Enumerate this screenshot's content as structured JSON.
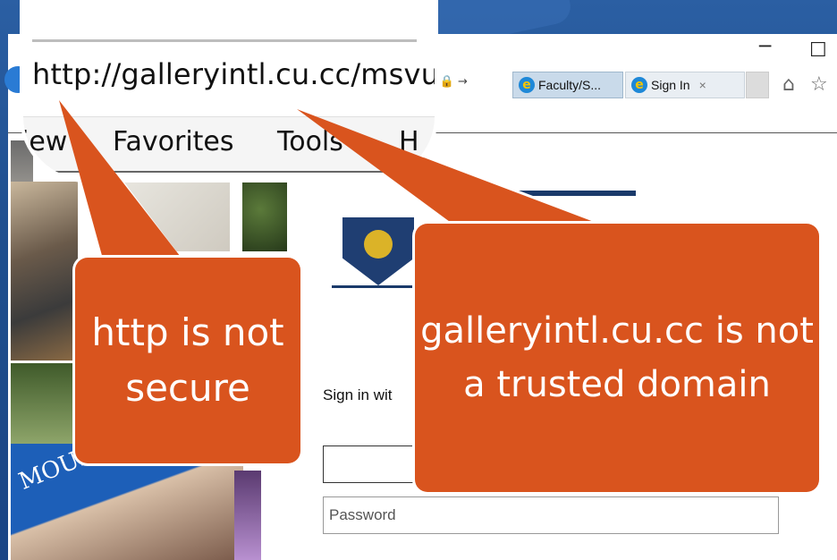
{
  "browser": {
    "address_url": "http://galleryintl.cu.cc/msvu",
    "address_tail": "▾ 🔒 →",
    "window_minimize": "─",
    "window_maximize": "☐",
    "tabs": [
      {
        "label": "Faculty/S...",
        "icon": "ie-icon"
      },
      {
        "label": "Sign In",
        "icon": "ie-icon",
        "close": "×"
      }
    ],
    "toolbar_icons": [
      "home-icon",
      "star-icon"
    ],
    "menu": [
      "iew",
      "Favorites",
      "Tools",
      "H"
    ]
  },
  "page": {
    "signin_text": "Sign in wit",
    "password_placeholder": "Password",
    "logo_text": "MOUNT SAINT VINCENT UNIVERSITY"
  },
  "callouts": {
    "http": "http is not secure",
    "domain": "galleryintl.cu.cc is not a trusted domain"
  },
  "colors": {
    "background": "#1f4f8f",
    "callout": "#d9541e"
  }
}
